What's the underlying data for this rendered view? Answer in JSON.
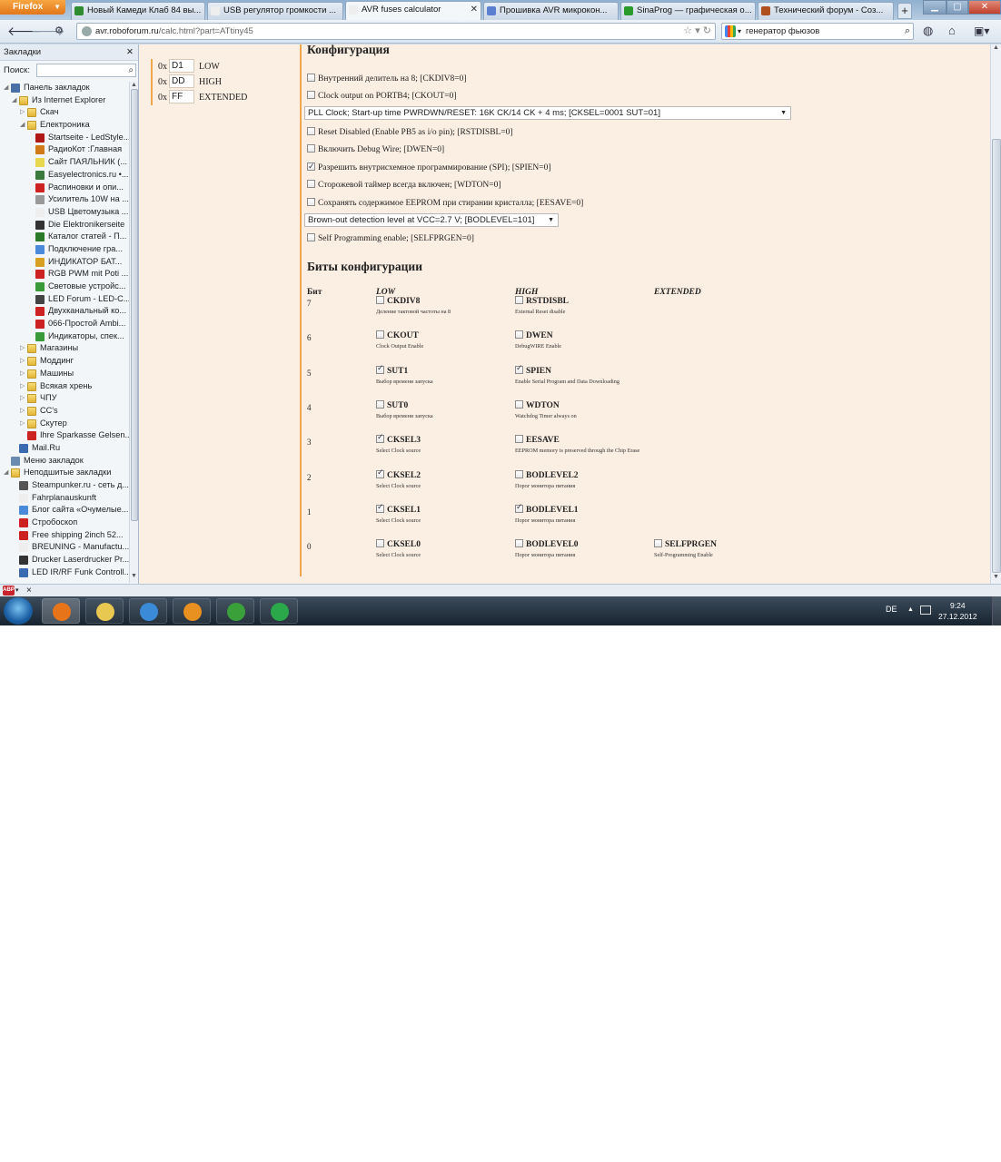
{
  "browser": {
    "menu_label": "Firefox",
    "tabs": [
      {
        "title": "Новый Камеди Клаб 84 вы...",
        "fav": "#2e8b2e"
      },
      {
        "title": "USB регулятор громкости ...",
        "fav": "#eeeeee"
      },
      {
        "title": "AVR fuses calculator",
        "fav": "#eeeeee"
      },
      {
        "title": "Прошивка AVR микрокон...",
        "fav": "#5b7fd0"
      },
      {
        "title": "SinaProg — графическая о...",
        "fav": "#2a9a2a"
      },
      {
        "title": "Технический форум - Соз...",
        "fav": "#b0501e"
      }
    ],
    "new_tab": "+",
    "url_domain": "avr.roboforum.ru",
    "url_path": "/calc.html?part=ATtiny45",
    "search_text": "генератор фьюзов"
  },
  "sidebar": {
    "title": "Закладки",
    "search_label": "Поиск:",
    "items": [
      {
        "label": "Панель закладок",
        "level": 0,
        "tw": "◢",
        "icon": "#4a6ea8"
      },
      {
        "label": "Из Internet Explorer",
        "level": 1,
        "tw": "◢",
        "icon": "folder"
      },
      {
        "label": "Скач",
        "level": 2,
        "tw": "▷",
        "icon": "folder"
      },
      {
        "label": "Електроника",
        "level": 2,
        "tw": "◢",
        "icon": "folder"
      },
      {
        "label": "Startseite - LedStyle...",
        "level": 3,
        "tw": "",
        "icon": "#b01818"
      },
      {
        "label": "РадиоКот :Главная",
        "level": 3,
        "tw": "",
        "icon": "#d07a1a"
      },
      {
        "label": "Сайт ПАЯЛЬНИК (...",
        "level": 3,
        "tw": "",
        "icon": "#e8d850"
      },
      {
        "label": "Easyelectronics.ru •...",
        "level": 3,
        "tw": "",
        "icon": "#3a7a3a"
      },
      {
        "label": "Распиновки и опи...",
        "level": 3,
        "tw": "",
        "icon": "#cc2222"
      },
      {
        "label": "Усилитель 10W на ...",
        "level": 3,
        "tw": "",
        "icon": "#999999"
      },
      {
        "label": "USB Цветомузыка ...",
        "level": 3,
        "tw": "",
        "icon": "#eeeeee"
      },
      {
        "label": "Die Elektronikerseite",
        "level": 3,
        "tw": "",
        "icon": "#333333"
      },
      {
        "label": "Каталог статей - П...",
        "level": 3,
        "tw": "",
        "icon": "#2a7a2a"
      },
      {
        "label": "Подключение гра...",
        "level": 3,
        "tw": "",
        "icon": "#4a8ad8"
      },
      {
        "label": "ИНДИКАТОР БАТ...",
        "level": 3,
        "tw": "",
        "icon": "#d8a020"
      },
      {
        "label": "RGB PWM mit Poti ...",
        "level": 3,
        "tw": "",
        "icon": "#cc2222"
      },
      {
        "label": "Световые устройс...",
        "level": 3,
        "tw": "",
        "icon": "#3a9a3a"
      },
      {
        "label": "LED Forum - LED-C...",
        "level": 3,
        "tw": "",
        "icon": "#444444"
      },
      {
        "label": "Двухканальный ко...",
        "level": 3,
        "tw": "",
        "icon": "#cc2222"
      },
      {
        "label": "066-Простой Ambi...",
        "level": 3,
        "tw": "",
        "icon": "#cc2222"
      },
      {
        "label": "Индикаторы, спек...",
        "level": 3,
        "tw": "",
        "icon": "#3a9a3a"
      },
      {
        "label": "Магазины",
        "level": 2,
        "tw": "▷",
        "icon": "folder"
      },
      {
        "label": "Моддинг",
        "level": 2,
        "tw": "▷",
        "icon": "folder"
      },
      {
        "label": "Машины",
        "level": 2,
        "tw": "▷",
        "icon": "folder"
      },
      {
        "label": "Всякая хрень",
        "level": 2,
        "tw": "▷",
        "icon": "folder"
      },
      {
        "label": "ЧПУ",
        "level": 2,
        "tw": "▷",
        "icon": "folder"
      },
      {
        "label": "CC's",
        "level": 2,
        "tw": "▷",
        "icon": "folder"
      },
      {
        "label": "Скутер",
        "level": 2,
        "tw": "▷",
        "icon": "folder"
      },
      {
        "label": "Ihre Sparkasse Gelsen...",
        "level": 2,
        "tw": "",
        "icon": "#cc2222"
      },
      {
        "label": "Mail.Ru",
        "level": 1,
        "tw": "",
        "icon": "#3a6ab0"
      },
      {
        "label": "Меню закладок",
        "level": 0,
        "tw": "",
        "icon": "#6a8ab0"
      },
      {
        "label": "Неподшитые закладки",
        "level": 0,
        "tw": "◢",
        "icon": "folder"
      },
      {
        "label": "Steampunker.ru - сеть д...",
        "level": 1,
        "tw": "",
        "icon": "#555555"
      },
      {
        "label": "Fahrplanauskunft",
        "level": 1,
        "tw": "",
        "icon": "#eeeeee"
      },
      {
        "label": "Блог сайта «Очумелые...",
        "level": 1,
        "tw": "",
        "icon": "#4a8ad8"
      },
      {
        "label": "Стробоскоп",
        "level": 1,
        "tw": "",
        "icon": "#cc2222"
      },
      {
        "label": "Free shipping 2inch 52...",
        "level": 1,
        "tw": "",
        "icon": "#cc2222"
      },
      {
        "label": "BREUNING - Manufactu...",
        "level": 1,
        "tw": "",
        "icon": "#eeeeee"
      },
      {
        "label": "Drucker Laserdrucker Pr...",
        "level": 1,
        "tw": "",
        "icon": "#333333"
      },
      {
        "label": "LED IR/RF Funk Controll...",
        "level": 1,
        "tw": "",
        "icon": "#3a6ab0"
      }
    ]
  },
  "fuses": [
    {
      "prefix": "0x",
      "value": "D1",
      "name": "LOW"
    },
    {
      "prefix": "0x",
      "value": "DD",
      "name": "HIGH"
    },
    {
      "prefix": "0x",
      "value": "FF",
      "name": "EXTENDED"
    }
  ],
  "config": {
    "title": "Конфигурация",
    "options": [
      {
        "kind": "cb",
        "checked": false,
        "label": "Внутренний делитель на 8; [CKDIV8=0]"
      },
      {
        "kind": "cb",
        "checked": false,
        "label": "Clock output on PORTB4; [CKOUT=0]"
      },
      {
        "kind": "sel",
        "label": "PLL Clock; Start-up time PWRDWN/RESET: 16K CK/14 CK + 4 ms; [CKSEL=0001 SUT=01]",
        "w": 536
      },
      {
        "kind": "cb",
        "checked": false,
        "label": "Reset Disabled (Enable PB5 as i/o pin); [RSTDISBL=0]"
      },
      {
        "kind": "cb",
        "checked": false,
        "label": "Включить Debug Wire; [DWEN=0]"
      },
      {
        "kind": "cb",
        "checked": true,
        "label": "Разрешить внутрисхемное программирование (SPI); [SPIEN=0]"
      },
      {
        "kind": "cb",
        "checked": false,
        "label": "Сторожевой таймер всегда включен; [WDTON=0]"
      },
      {
        "kind": "cb",
        "checked": false,
        "label": "Сохранять содержимое EEPROM при стирании кристалла; [EESAVE=0]"
      },
      {
        "kind": "sel",
        "label": "Brown-out detection level at VCC=2.7 V; [BODLEVEL=101]",
        "w": 280
      },
      {
        "kind": "cb",
        "checked": false,
        "label": "Self Programming enable; [SELFPRGEN=0]"
      }
    ]
  },
  "bits": {
    "title": "Биты конфигурации",
    "col_bit": "Бит",
    "col_low": "LOW",
    "col_high": "HIGH",
    "col_ext": "EXTENDED",
    "rows": [
      {
        "n": "7",
        "low": {
          "name": "CKDIV8",
          "desc": "Деление тактовой частоты на 8",
          "checked": false
        },
        "high": {
          "name": "RSTDISBL",
          "desc": "External Reset disable",
          "checked": false
        }
      },
      {
        "n": "6",
        "low": {
          "name": "CKOUT",
          "desc": "Clock Output Enable",
          "checked": false
        },
        "high": {
          "name": "DWEN",
          "desc": "DebugWIRE Enable",
          "checked": false
        }
      },
      {
        "n": "5",
        "low": {
          "name": "SUT1",
          "desc": "Выбор времени запуска",
          "checked": true
        },
        "high": {
          "name": "SPIEN",
          "desc": "Enable Serial Program and Data Downloading",
          "checked": true
        }
      },
      {
        "n": "4",
        "low": {
          "name": "SUT0",
          "desc": "Выбор времени запуска",
          "checked": false
        },
        "high": {
          "name": "WDTON",
          "desc": "Watchdog Timer always on",
          "checked": false
        }
      },
      {
        "n": "3",
        "low": {
          "name": "CKSEL3",
          "desc": "Select Clock source",
          "checked": true
        },
        "high": {
          "name": "EESAVE",
          "desc": "EEPROM memory is preserved through the Chip Erase",
          "checked": false
        }
      },
      {
        "n": "2",
        "low": {
          "name": "CKSEL2",
          "desc": "Select Clock source",
          "checked": true
        },
        "high": {
          "name": "BODLEVEL2",
          "desc": "Порог монитора питания",
          "checked": false
        }
      },
      {
        "n": "1",
        "low": {
          "name": "CKSEL1",
          "desc": "Select Clock source",
          "checked": true
        },
        "high": {
          "name": "BODLEVEL1",
          "desc": "Порог монитора питания",
          "checked": true
        }
      },
      {
        "n": "0",
        "low": {
          "name": "CKSEL0",
          "desc": "Select Clock source",
          "checked": false
        },
        "high": {
          "name": "BODLEVEL0",
          "desc": "Порог монитора питания",
          "checked": false
        },
        "ext": {
          "name": "SELFPRGEN",
          "desc": "Self-Programming Enable",
          "checked": false
        }
      }
    ]
  },
  "addon": {
    "close": "×",
    "abp": "ABP"
  },
  "taskbar": {
    "apps": [
      {
        "name": "firefox",
        "color": "#e8741a",
        "active": true
      },
      {
        "name": "explorer",
        "color": "#e8c850",
        "active": false
      },
      {
        "name": "ie",
        "color": "#3a8ad8",
        "active": false
      },
      {
        "name": "media-player",
        "color": "#e89020",
        "active": false
      },
      {
        "name": "utorrent",
        "color": "#3aa03a",
        "active": false
      },
      {
        "name": "mail-agent",
        "color": "#2aa84a",
        "active": false
      }
    ],
    "lang": "DE",
    "time": "9:24",
    "date": "27.12.2012"
  }
}
